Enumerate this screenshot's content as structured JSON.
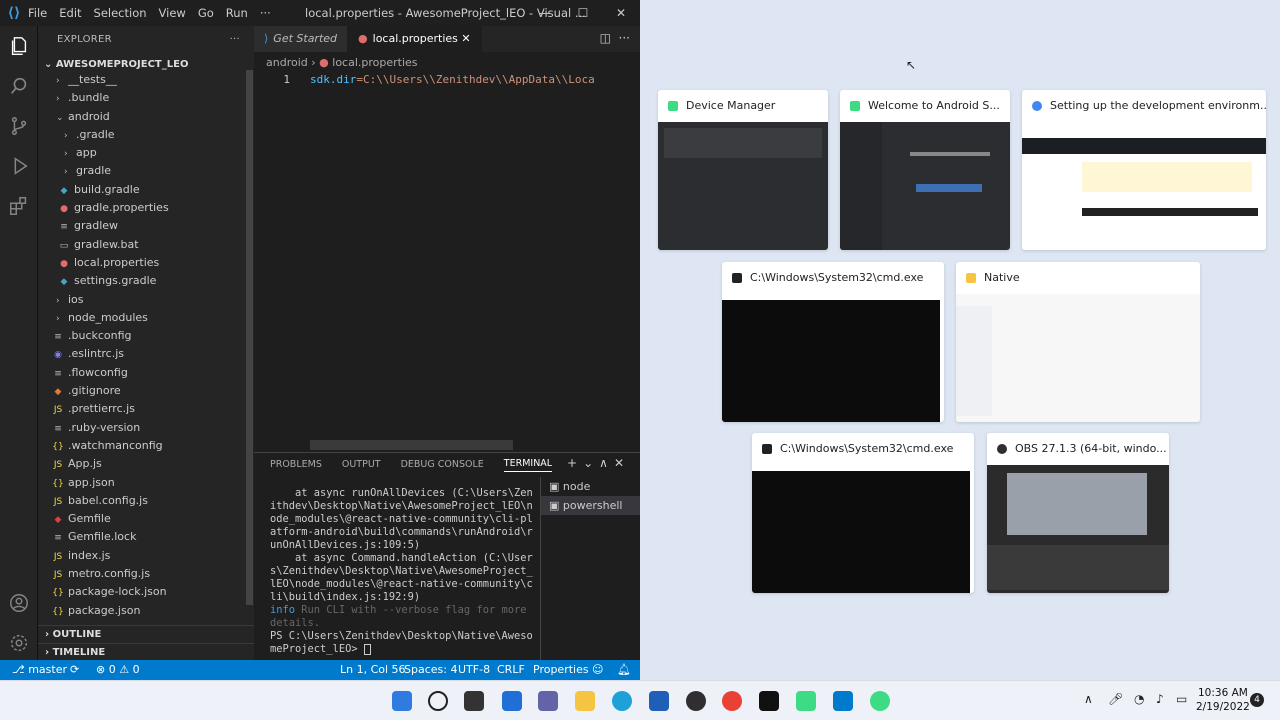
{
  "vscode": {
    "menu": [
      "File",
      "Edit",
      "Selection",
      "View",
      "Go",
      "Run",
      "···"
    ],
    "window_title": "local.properties - AwesomeProject_lEO - Visual ...",
    "explorer_title": "EXPLORER",
    "project": "AWESOMEPROJECT_LEO",
    "tree": [
      {
        "label": "__tests__",
        "icon": "folder",
        "depth": 1
      },
      {
        "label": ".bundle",
        "icon": "folder",
        "depth": 1
      },
      {
        "label": "android",
        "icon": "folder-open",
        "depth": 1
      },
      {
        "label": ".gradle",
        "icon": "folder",
        "depth": 2
      },
      {
        "label": "app",
        "icon": "folder",
        "depth": 2
      },
      {
        "label": "gradle",
        "icon": "folder",
        "depth": 2
      },
      {
        "label": "build.gradle",
        "icon": "gradle-icon",
        "depth": 2
      },
      {
        "label": "gradle.properties",
        "icon": "properties-icon",
        "depth": 2
      },
      {
        "label": "gradlew",
        "icon": "file-icon",
        "depth": 2
      },
      {
        "label": "gradlew.bat",
        "icon": "bat-icon",
        "depth": 2
      },
      {
        "label": "local.properties",
        "icon": "properties-icon",
        "depth": 2
      },
      {
        "label": "settings.gradle",
        "icon": "gradle-icon",
        "depth": 2
      },
      {
        "label": "ios",
        "icon": "folder",
        "depth": 1
      },
      {
        "label": "node_modules",
        "icon": "folder",
        "depth": 1
      },
      {
        "label": ".buckconfig",
        "icon": "file-icon",
        "depth": 1
      },
      {
        "label": ".eslintrc.js",
        "icon": "eslint-icon",
        "depth": 1
      },
      {
        "label": ".flowconfig",
        "icon": "file-icon",
        "depth": 1
      },
      {
        "label": ".gitignore",
        "icon": "git-icon",
        "depth": 1
      },
      {
        "label": ".prettierrc.js",
        "icon": "js-icon",
        "depth": 1
      },
      {
        "label": ".ruby-version",
        "icon": "file-icon",
        "depth": 1
      },
      {
        "label": ".watchmanconfig",
        "icon": "json-icon",
        "depth": 1
      },
      {
        "label": "App.js",
        "icon": "js-icon",
        "depth": 1
      },
      {
        "label": "app.json",
        "icon": "json-icon",
        "depth": 1
      },
      {
        "label": "babel.config.js",
        "icon": "js-icon",
        "depth": 1
      },
      {
        "label": "Gemfile",
        "icon": "ruby-icon",
        "depth": 1
      },
      {
        "label": "Gemfile.lock",
        "icon": "file-icon",
        "depth": 1
      },
      {
        "label": "index.js",
        "icon": "js-icon",
        "depth": 1
      },
      {
        "label": "metro.config.js",
        "icon": "js-icon",
        "depth": 1
      },
      {
        "label": "package-lock.json",
        "icon": "json-icon",
        "depth": 1
      },
      {
        "label": "package.json",
        "icon": "json-icon",
        "depth": 1
      }
    ],
    "sections": [
      "OUTLINE",
      "TIMELINE"
    ],
    "tabs": [
      {
        "label": "Get Started",
        "active": false
      },
      {
        "label": "local.properties",
        "active": true
      }
    ],
    "breadcrumb": [
      "android",
      "local.properties"
    ],
    "code_line_no": "1",
    "code_key": "sdk.dir",
    "code_value": "=C:\\\\Users\\\\Zenithdev\\\\AppData\\\\Loca",
    "panel_tabs": [
      "PROBLEMS",
      "OUTPUT",
      "DEBUG CONSOLE",
      "TERMINAL"
    ],
    "terminal_lines": [
      "    at async runOnAllDevices (C:\\Users\\Zen",
      "ithdev\\Desktop\\Native\\AwesomeProject_lEO\\n",
      "ode_modules\\@react-native-community\\cli-pl",
      "atform-android\\build\\commands\\runAndroid\\r",
      "unOnAllDevices.js:109:5)",
      "    at async Command.handleAction (C:\\User",
      "s\\Zenithdev\\Desktop\\Native\\AwesomeProject_",
      "lEO\\node_modules\\@react-native-community\\c",
      "li\\build\\index.js:192:9)"
    ],
    "terminal_info_word": "info",
    "terminal_info_rest": " Run CLI with --verbose flag for more",
    "terminal_info_rest2": "details.",
    "terminal_prompt1": "PS C:\\Users\\Zenithdev\\Desktop\\Native\\Aweso",
    "terminal_prompt2": "meProject_lEO> ",
    "terminal_list": [
      "node",
      "powershell"
    ],
    "status": {
      "branch": "master",
      "problems": "⊗ 0 ⚠ 0",
      "position": "Ln 1, Col 56",
      "spaces": "Spaces: 4",
      "encoding": "UTF-8",
      "eol": "CRLF",
      "language": "Properties"
    }
  },
  "snap_windows": [
    {
      "title": "Device Manager",
      "app_color": "#3ddc84"
    },
    {
      "title": "Welcome to Android S...",
      "app_color": "#3ddc84"
    },
    {
      "title": "Setting up the development environm...",
      "app_color": "#4285f4"
    },
    {
      "title": "C:\\Windows\\System32\\cmd.exe",
      "app_color": "#222222"
    },
    {
      "title": "Native",
      "app_color": "#f5c542"
    },
    {
      "title": "C:\\Windows\\System32\\cmd.exe",
      "app_color": "#222222"
    },
    {
      "title": "OBS 27.1.3 (64-bit, windo...",
      "app_color": "#302e31"
    }
  ],
  "taskbar": {
    "time": "10:36 AM",
    "date": "2/19/2022",
    "notification_count": "4"
  },
  "colors": {
    "vscode_accent": "#007acc",
    "desktop_bg": "#dde6f2"
  }
}
